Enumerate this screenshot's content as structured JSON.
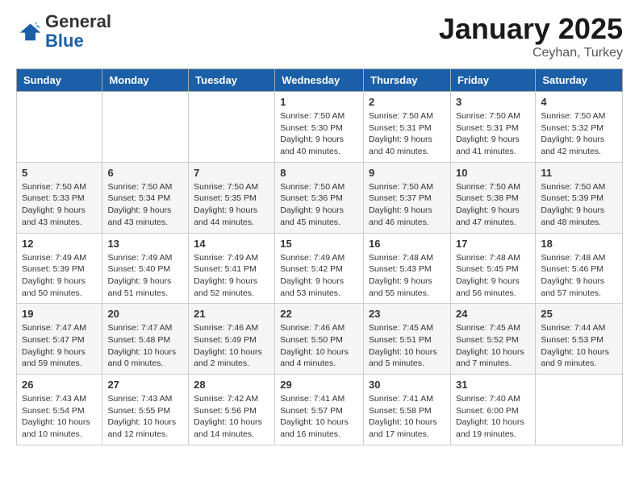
{
  "header": {
    "logo_general": "General",
    "logo_blue": "Blue",
    "title": "January 2025",
    "location": "Ceyhan, Turkey"
  },
  "days_of_week": [
    "Sunday",
    "Monday",
    "Tuesday",
    "Wednesday",
    "Thursday",
    "Friday",
    "Saturday"
  ],
  "weeks": [
    [
      {
        "day": "",
        "info": ""
      },
      {
        "day": "",
        "info": ""
      },
      {
        "day": "",
        "info": ""
      },
      {
        "day": "1",
        "info": "Sunrise: 7:50 AM\nSunset: 5:30 PM\nDaylight: 9 hours and 40 minutes."
      },
      {
        "day": "2",
        "info": "Sunrise: 7:50 AM\nSunset: 5:31 PM\nDaylight: 9 hours and 40 minutes."
      },
      {
        "day": "3",
        "info": "Sunrise: 7:50 AM\nSunset: 5:31 PM\nDaylight: 9 hours and 41 minutes."
      },
      {
        "day": "4",
        "info": "Sunrise: 7:50 AM\nSunset: 5:32 PM\nDaylight: 9 hours and 42 minutes."
      }
    ],
    [
      {
        "day": "5",
        "info": "Sunrise: 7:50 AM\nSunset: 5:33 PM\nDaylight: 9 hours and 43 minutes."
      },
      {
        "day": "6",
        "info": "Sunrise: 7:50 AM\nSunset: 5:34 PM\nDaylight: 9 hours and 43 minutes."
      },
      {
        "day": "7",
        "info": "Sunrise: 7:50 AM\nSunset: 5:35 PM\nDaylight: 9 hours and 44 minutes."
      },
      {
        "day": "8",
        "info": "Sunrise: 7:50 AM\nSunset: 5:36 PM\nDaylight: 9 hours and 45 minutes."
      },
      {
        "day": "9",
        "info": "Sunrise: 7:50 AM\nSunset: 5:37 PM\nDaylight: 9 hours and 46 minutes."
      },
      {
        "day": "10",
        "info": "Sunrise: 7:50 AM\nSunset: 5:38 PM\nDaylight: 9 hours and 47 minutes."
      },
      {
        "day": "11",
        "info": "Sunrise: 7:50 AM\nSunset: 5:39 PM\nDaylight: 9 hours and 48 minutes."
      }
    ],
    [
      {
        "day": "12",
        "info": "Sunrise: 7:49 AM\nSunset: 5:39 PM\nDaylight: 9 hours and 50 minutes."
      },
      {
        "day": "13",
        "info": "Sunrise: 7:49 AM\nSunset: 5:40 PM\nDaylight: 9 hours and 51 minutes."
      },
      {
        "day": "14",
        "info": "Sunrise: 7:49 AM\nSunset: 5:41 PM\nDaylight: 9 hours and 52 minutes."
      },
      {
        "day": "15",
        "info": "Sunrise: 7:49 AM\nSunset: 5:42 PM\nDaylight: 9 hours and 53 minutes."
      },
      {
        "day": "16",
        "info": "Sunrise: 7:48 AM\nSunset: 5:43 PM\nDaylight: 9 hours and 55 minutes."
      },
      {
        "day": "17",
        "info": "Sunrise: 7:48 AM\nSunset: 5:45 PM\nDaylight: 9 hours and 56 minutes."
      },
      {
        "day": "18",
        "info": "Sunrise: 7:48 AM\nSunset: 5:46 PM\nDaylight: 9 hours and 57 minutes."
      }
    ],
    [
      {
        "day": "19",
        "info": "Sunrise: 7:47 AM\nSunset: 5:47 PM\nDaylight: 9 hours and 59 minutes."
      },
      {
        "day": "20",
        "info": "Sunrise: 7:47 AM\nSunset: 5:48 PM\nDaylight: 10 hours and 0 minutes."
      },
      {
        "day": "21",
        "info": "Sunrise: 7:46 AM\nSunset: 5:49 PM\nDaylight: 10 hours and 2 minutes."
      },
      {
        "day": "22",
        "info": "Sunrise: 7:46 AM\nSunset: 5:50 PM\nDaylight: 10 hours and 4 minutes."
      },
      {
        "day": "23",
        "info": "Sunrise: 7:45 AM\nSunset: 5:51 PM\nDaylight: 10 hours and 5 minutes."
      },
      {
        "day": "24",
        "info": "Sunrise: 7:45 AM\nSunset: 5:52 PM\nDaylight: 10 hours and 7 minutes."
      },
      {
        "day": "25",
        "info": "Sunrise: 7:44 AM\nSunset: 5:53 PM\nDaylight: 10 hours and 9 minutes."
      }
    ],
    [
      {
        "day": "26",
        "info": "Sunrise: 7:43 AM\nSunset: 5:54 PM\nDaylight: 10 hours and 10 minutes."
      },
      {
        "day": "27",
        "info": "Sunrise: 7:43 AM\nSunset: 5:55 PM\nDaylight: 10 hours and 12 minutes."
      },
      {
        "day": "28",
        "info": "Sunrise: 7:42 AM\nSunset: 5:56 PM\nDaylight: 10 hours and 14 minutes."
      },
      {
        "day": "29",
        "info": "Sunrise: 7:41 AM\nSunset: 5:57 PM\nDaylight: 10 hours and 16 minutes."
      },
      {
        "day": "30",
        "info": "Sunrise: 7:41 AM\nSunset: 5:58 PM\nDaylight: 10 hours and 17 minutes."
      },
      {
        "day": "31",
        "info": "Sunrise: 7:40 AM\nSunset: 6:00 PM\nDaylight: 10 hours and 19 minutes."
      },
      {
        "day": "",
        "info": ""
      }
    ]
  ]
}
